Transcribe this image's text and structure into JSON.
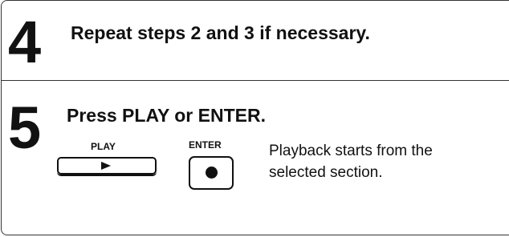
{
  "steps": [
    {
      "number": "4",
      "title": "Repeat steps 2 and 3 if necessary."
    },
    {
      "number": "5",
      "title": "Press PLAY or ENTER.",
      "buttons": {
        "play_label": "PLAY",
        "play_icon": "play-arrow-icon",
        "enter_label": "ENTER",
        "enter_icon": "filled-circle-icon"
      },
      "description_lines": [
        "Playback starts from the",
        "selected section."
      ]
    }
  ]
}
